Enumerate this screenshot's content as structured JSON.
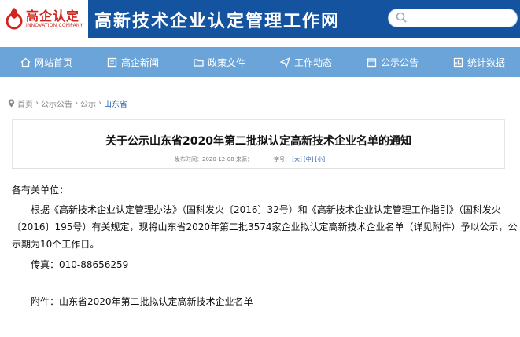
{
  "header": {
    "logo_text": "高企认定",
    "logo_sub": "INNOVATION COMPANY",
    "site_title": "高新技术企业认定管理工作网",
    "colors": {
      "bar": "#14539f",
      "nav": "#6aa4d9",
      "logo_red": "#d1261f"
    }
  },
  "nav": {
    "items": [
      {
        "label": "网站首页",
        "icon": "home-icon"
      },
      {
        "label": "高企新闻",
        "icon": "news-icon"
      },
      {
        "label": "政策文件",
        "icon": "folder-icon"
      },
      {
        "label": "工作动态",
        "icon": "paper-plane-icon"
      },
      {
        "label": "公示公告",
        "icon": "notice-icon"
      },
      {
        "label": "统计数据",
        "icon": "chart-icon"
      }
    ]
  },
  "breadcrumb": {
    "items": [
      "首页",
      "公示公告",
      "公示",
      "山东省"
    ],
    "separator": "›"
  },
  "article": {
    "title": "关于公示山东省2020年第二批拟认定高新技术企业名单的通知",
    "meta": "发布时间：2020-12-08  来源：",
    "font_label": "字号：",
    "font_large": "[大]",
    "font_medium": "[中]",
    "font_small": "[小]",
    "salutation": "各有关单位：",
    "para1_line1": "根据《高新技术企业认定管理办法》（国科发火〔2016〕32号）和《高新技术企业认定管理工作指引》（国科发火",
    "para1_line2": "〔2016〕195号）有关规定，现将山东省2020年第二批3574家企业拟认定高新技术企业名单（详见附件）予以公示，公",
    "para1_line3": "示期为10个工作日。",
    "fax": "传真：010-88656259",
    "attachment": "附件：山东省2020年第二批拟认定高新技术企业名单"
  }
}
